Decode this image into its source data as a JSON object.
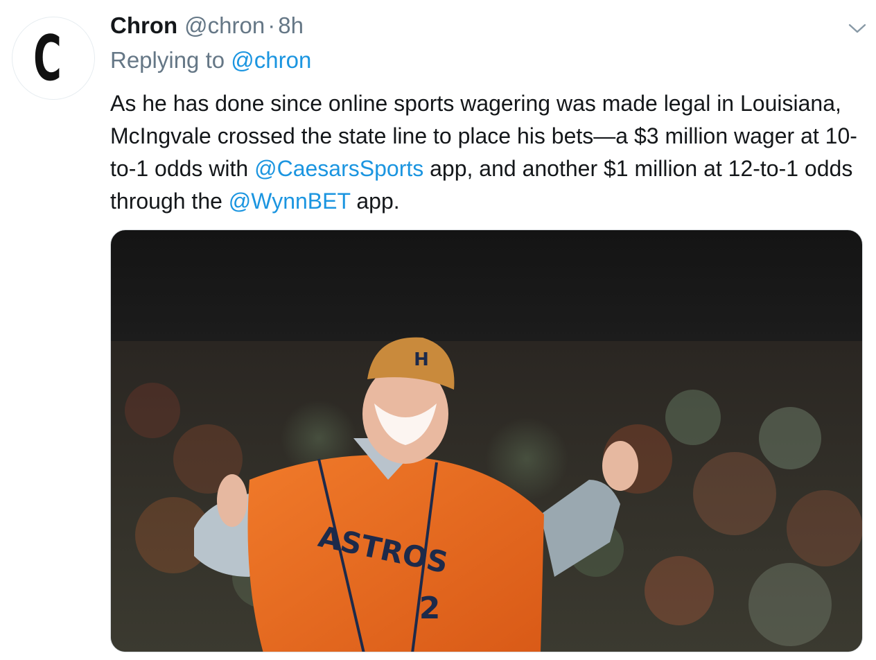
{
  "tweet": {
    "display_name": "Chron",
    "handle": "@chron",
    "separator": "·",
    "time": "8h",
    "reply_prefix": "Replying to",
    "reply_to": "@chron",
    "text_segments": [
      "As he has done since online sports wagering was made legal in Louisiana, McIngvale crossed the state line to place his bets—a $3 million wager at 10-to-1 odds with ",
      "@CaesarsSports",
      " app, and another $1 million at 12-to-1 odds through the ",
      "@WynnBET",
      " app."
    ],
    "media": {
      "jersey_text": "ASTROS",
      "jersey_number": "2",
      "cap_logo": "H"
    }
  },
  "icons": {
    "avatar": "chron-logo-icon",
    "menu": "chevron-down-icon"
  },
  "colors": {
    "link": "#1b95e0",
    "text": "#14171a",
    "secondary": "#657786",
    "brand_dot": "#1ea7ec",
    "jersey": "#e8671f"
  }
}
